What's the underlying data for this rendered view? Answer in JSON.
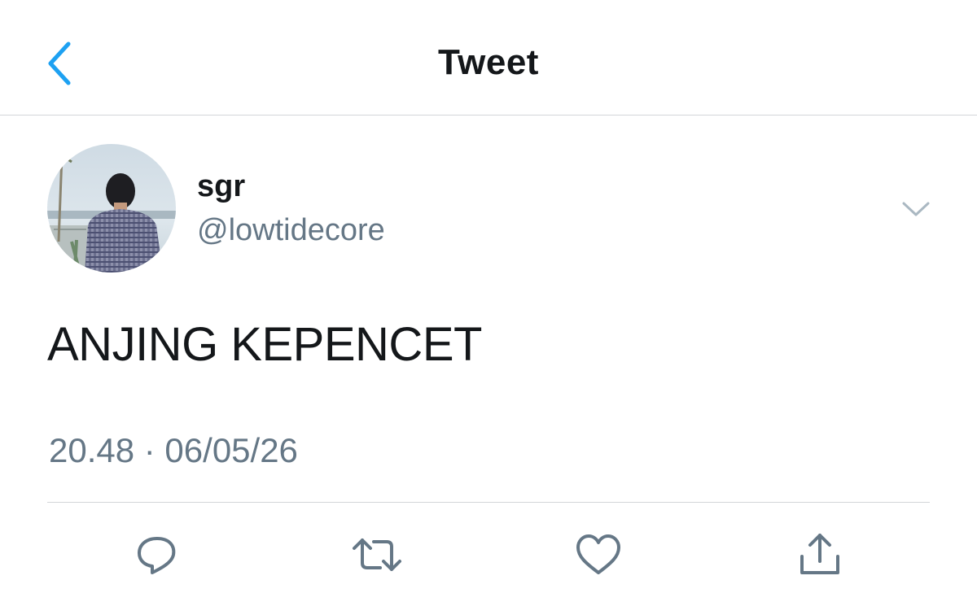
{
  "header": {
    "title": "Tweet",
    "back_icon": "chevron-left-icon"
  },
  "colors": {
    "accent": "#1da1f2",
    "text": "#14171a",
    "secondary": "#657786",
    "divider": "#d3d6d9"
  },
  "tweet": {
    "author": {
      "display_name": "sgr",
      "handle": "@lowtidecore"
    },
    "text": "ANJING KEPENCET",
    "timestamp": "20.48 · 06/05/26"
  },
  "actions": [
    {
      "icon": "reply-icon"
    },
    {
      "icon": "retweet-icon"
    },
    {
      "icon": "like-icon"
    },
    {
      "icon": "share-icon"
    }
  ]
}
